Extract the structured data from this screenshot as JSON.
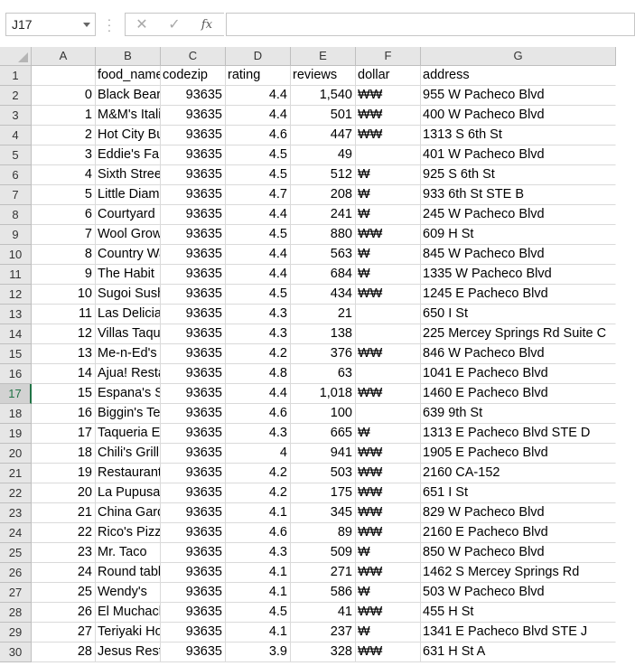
{
  "name_box": {
    "value": "J17"
  },
  "formula_bar": {
    "cancel_glyph": "✕",
    "enter_glyph": "✓",
    "fx_label": "fx",
    "formula": ""
  },
  "columns": [
    "A",
    "B",
    "C",
    "D",
    "E",
    "F",
    "G"
  ],
  "active_row": 17,
  "header": [
    "",
    "food_name",
    "codezip",
    "rating",
    "reviews",
    "dollar",
    "address"
  ],
  "rows": [
    [
      "0",
      "Black Bear",
      "93635",
      "4.4",
      "1,540",
      "₩₩",
      "955 W Pacheco Blvd"
    ],
    [
      "1",
      "M&M's Italian",
      "93635",
      "4.4",
      "501",
      "₩₩",
      "400 W Pacheco Blvd"
    ],
    [
      "2",
      "Hot City Burger",
      "93635",
      "4.6",
      "447",
      "₩₩",
      "1313 S 6th St"
    ],
    [
      "3",
      "Eddie's Famous",
      "93635",
      "4.5",
      "49",
      "",
      "401 W Pacheco Blvd"
    ],
    [
      "4",
      "Sixth Street",
      "93635",
      "4.5",
      "512",
      "₩",
      "925 S 6th St"
    ],
    [
      "5",
      "Little Diamond",
      "93635",
      "4.7",
      "208",
      "₩",
      "933 6th St STE B"
    ],
    [
      "6",
      "Courtyard",
      "93635",
      "4.4",
      "241",
      "₩",
      "245 W Pacheco Blvd"
    ],
    [
      "7",
      "Wool Growers",
      "93635",
      "4.5",
      "880",
      "₩₩",
      "609 H St"
    ],
    [
      "8",
      "Country Waffles",
      "93635",
      "4.4",
      "563",
      "₩",
      "845 W Pacheco Blvd"
    ],
    [
      "9",
      "The Habit",
      "93635",
      "4.4",
      "684",
      "₩",
      "1335 W Pacheco Blvd"
    ],
    [
      "10",
      "Sugoi Sushi",
      "93635",
      "4.5",
      "434",
      "₩₩",
      "1245 E Pacheco Blvd"
    ],
    [
      "11",
      "Las Delicias",
      "93635",
      "4.3",
      "21",
      "",
      "650 I St"
    ],
    [
      "12",
      "Villas Taqueria",
      "93635",
      "4.3",
      "138",
      "",
      "225 Mercey Springs Rd Suite C"
    ],
    [
      "13",
      "Me-n-Ed's",
      "93635",
      "4.2",
      "376",
      "₩₩",
      "846 W Pacheco Blvd"
    ],
    [
      "14",
      "Ajua! Restaurant",
      "93635",
      "4.8",
      "63",
      "",
      "1041 E Pacheco Blvd"
    ],
    [
      "15",
      "Espana's Southwest",
      "93635",
      "4.4",
      "1,018",
      "₩₩",
      "1460 E Pacheco Blvd"
    ],
    [
      "16",
      "Biggin's Tea",
      "93635",
      "4.6",
      "100",
      "",
      "639 9th St"
    ],
    [
      "17",
      "Taqueria El",
      "93635",
      "4.3",
      "665",
      "₩",
      "1313 E Pacheco Blvd STE D"
    ],
    [
      "18",
      "Chili's Grill",
      "93635",
      "4",
      "941",
      "₩₩",
      "1905 E Pacheco Blvd"
    ],
    [
      "19",
      "Restaurant",
      "93635",
      "4.2",
      "503",
      "₩₩",
      "2160 CA-152"
    ],
    [
      "20",
      "La Pupusa",
      "93635",
      "4.2",
      "175",
      "₩₩",
      "651 I St"
    ],
    [
      "21",
      "China Garden",
      "93635",
      "4.1",
      "345",
      "₩₩",
      "829 W Pacheco Blvd"
    ],
    [
      "22",
      "Rico's Pizza",
      "93635",
      "4.6",
      "89",
      "₩₩",
      "2160 E Pacheco Blvd"
    ],
    [
      "23",
      "Mr. Taco",
      "93635",
      "4.3",
      "509",
      "₩",
      "850 W Pacheco Blvd"
    ],
    [
      "24",
      "Round table",
      "93635",
      "4.1",
      "271",
      "₩₩",
      "1462 S Mercey Springs Rd"
    ],
    [
      "25",
      "Wendy's",
      "93635",
      "4.1",
      "586",
      "₩",
      "503 W Pacheco Blvd"
    ],
    [
      "26",
      "El Muchacho",
      "93635",
      "4.5",
      "41",
      "₩₩",
      "455 H St"
    ],
    [
      "27",
      "Teriyaki House",
      "93635",
      "4.1",
      "237",
      "₩",
      "1341 E Pacheco Blvd STE J"
    ],
    [
      "28",
      "Jesus Restaurant",
      "93635",
      "3.9",
      "328",
      "₩₩",
      "631 H St A"
    ]
  ]
}
